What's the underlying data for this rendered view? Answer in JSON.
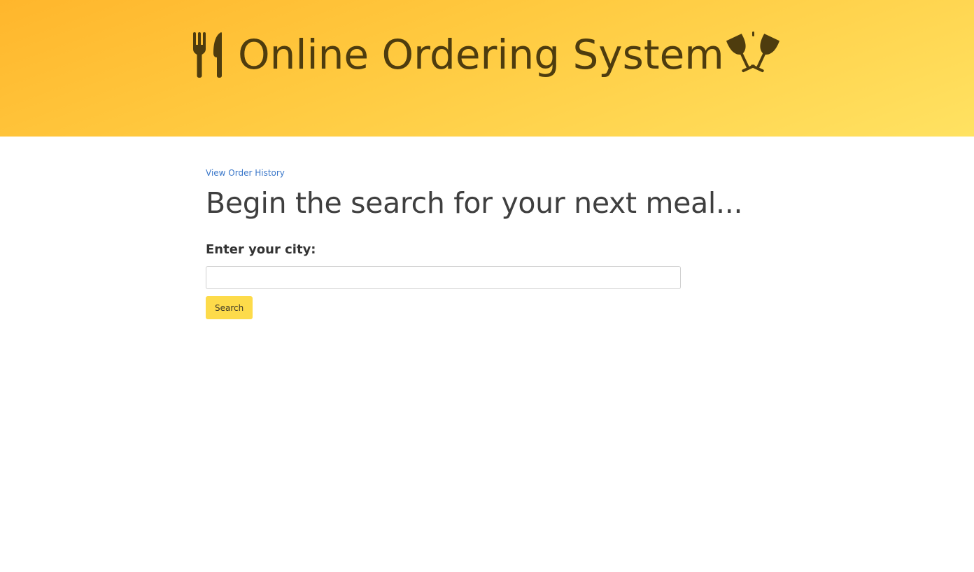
{
  "header": {
    "title": "Online Ordering System",
    "left_icon": "utensils-icon",
    "right_icon": "glasses-cheers-icon",
    "gradient_colors": [
      "#ffb62c",
      "#ffe262"
    ],
    "text_color": "#4e3c0e"
  },
  "main": {
    "history_link": "View Order History",
    "heading": "Begin the search for your next meal...",
    "city_label": "Enter your city:",
    "city_input": {
      "value": "",
      "placeholder": ""
    },
    "search_button": "Search",
    "accent_color": "#fddb4a",
    "link_color": "#3a77c9"
  }
}
